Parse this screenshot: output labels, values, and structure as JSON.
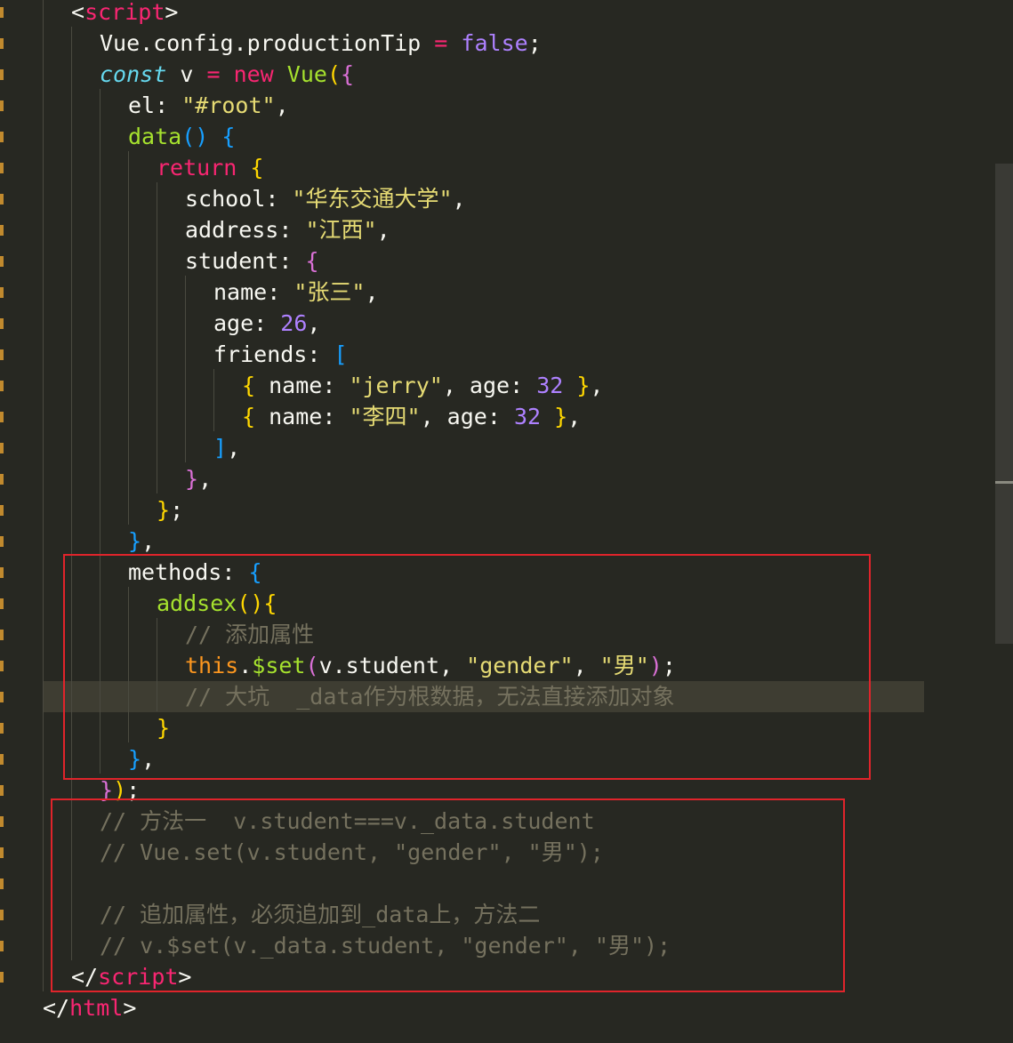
{
  "colors": {
    "background": "#272822",
    "keyword": "#F92672",
    "function": "#A6E22E",
    "string": "#E6DB74",
    "number": "#AE81FF",
    "comment": "#75715E",
    "highlight_box": "#E0242B"
  },
  "lines": {
    "l1_open_tag": "script",
    "l2_lhs": "Vue.config.productionTip",
    "l2_val": "false",
    "l3_const": "const",
    "l3_var": "v",
    "l3_new": "new",
    "l3_cls": "Vue",
    "l4_key": "el",
    "l4_val": "\"#root\"",
    "l5_fn": "data",
    "l6_kw": "return",
    "l7_key": "school",
    "l7_val": "\"华东交通大学\"",
    "l8_key": "address",
    "l8_val": "\"江西\"",
    "l9_key": "student",
    "l10_key": "name",
    "l10_val": "\"张三\"",
    "l11_key": "age",
    "l11_val": "26",
    "l12_key": "friends",
    "l13_name_key": "name",
    "l13_name_val": "\"jerry\"",
    "l13_age_key": "age",
    "l13_age_val": "32",
    "l14_name_key": "name",
    "l14_name_val": "\"李四\"",
    "l14_age_key": "age",
    "l14_age_val": "32",
    "l19_key": "methods",
    "l20_fn": "addsex",
    "l21_comment": "// 添加属性",
    "l22_this": "this",
    "l22_method": "$set",
    "l22_arg1": "v.student",
    "l22_arg2": "\"gender\"",
    "l22_arg3": "\"男\"",
    "l23_comment": "// 大坑  _data作为根数据，无法直接添加对象",
    "l27_comment": "// 方法一  v.student===v._data.student",
    "l28_comment": "// Vue.set(v.student, \"gender\", \"男\");",
    "l30_comment": "// 追加属性，必须追加到_data上，方法二",
    "l31_comment": "// v.$set(v._data.student, \"gender\", \"男\");",
    "l32_close_tag": "script",
    "l33_close_tag": "html"
  }
}
